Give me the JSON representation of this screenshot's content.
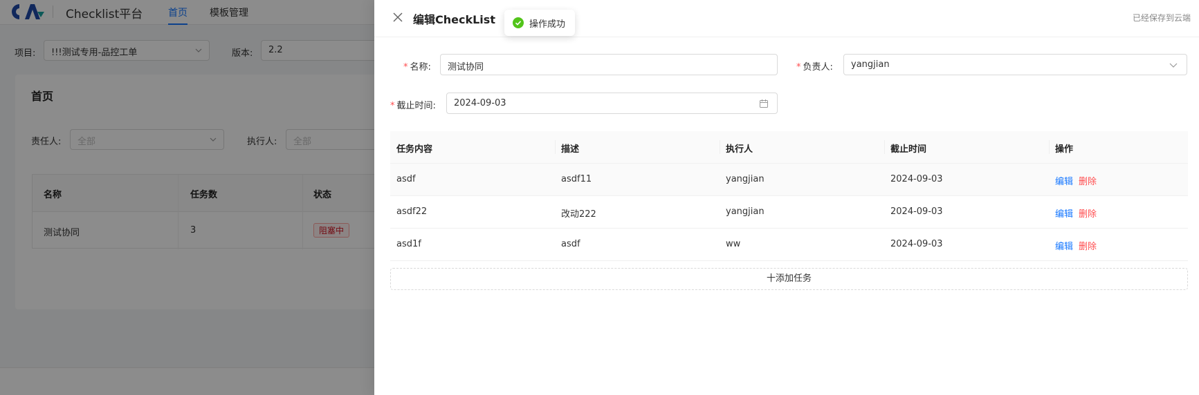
{
  "app": {
    "title": "Checklist平台",
    "nav": [
      {
        "label": "首页"
      },
      {
        "label": "模板管理"
      }
    ]
  },
  "filters": {
    "project_label": "项目:",
    "project_value": "!!!测试专用-品控工单",
    "version_label": "版本:",
    "version_value": "2.2"
  },
  "home": {
    "title": "首页",
    "owner_label": "责任人:",
    "owner_placeholder": "全部",
    "executor_label": "执行人:",
    "executor_placeholder": "全部",
    "table": {
      "headers": [
        "名称",
        "任务数",
        "状态"
      ],
      "rows": [
        {
          "name": "测试协同",
          "count": "3",
          "status": "阻塞中"
        }
      ]
    }
  },
  "drawer": {
    "title": "编辑CheckList",
    "save_status": "已经保存到云端",
    "form": {
      "name_label": "名称:",
      "name_value": "测试协同",
      "owner_label": "负责人:",
      "owner_value": "yangjian",
      "deadline_label": "截止时间:",
      "deadline_value": "2024-09-03"
    },
    "table": {
      "headers": [
        "任务内容",
        "描述",
        "执行人",
        "截止时间",
        "操作"
      ],
      "edit_label": "编辑",
      "delete_label": "删除",
      "rows": [
        {
          "content": "asdf",
          "desc": "asdf11",
          "executor": "yangjian",
          "deadline": "2024-09-03"
        },
        {
          "content": "asdf22",
          "desc": "改动222",
          "executor": "yangjian",
          "deadline": "2024-09-03"
        },
        {
          "content": "asd1f",
          "desc": "asdf",
          "executor": "ww",
          "deadline": "2024-09-03"
        }
      ]
    },
    "add_task_label": "十添加任务"
  },
  "toast": {
    "message": "操作成功"
  },
  "colors": {
    "primary": "#1677ff",
    "danger": "#ff4d4f",
    "success": "#52c41a"
  }
}
